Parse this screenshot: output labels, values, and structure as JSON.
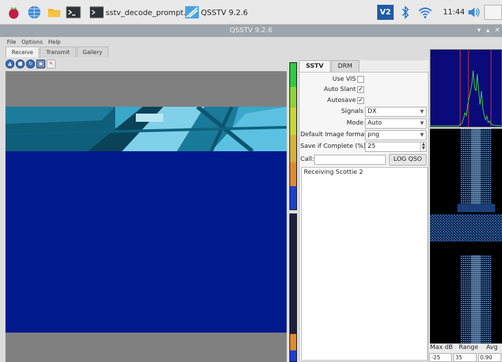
{
  "taskbar": {
    "tasks": [
      {
        "label": "sstv_decode_prompt.sh"
      },
      {
        "label": "QSSTV 9.2.6"
      }
    ],
    "clock": "11:44",
    "tray_v2": "V2"
  },
  "window": {
    "title": "QSSTV 9.2.6"
  },
  "menu": [
    "File",
    "Options",
    "Help"
  ],
  "main_tabs": [
    "Receive",
    "Transmit",
    "Gallery"
  ],
  "panel": {
    "tabs": [
      "SSTV",
      "DRM"
    ],
    "use_vis_label": "Use VIS",
    "use_vis_checked": false,
    "auto_slant_label": "Auto Slant",
    "auto_slant_checked": true,
    "autosave_label": "Autosave",
    "autosave_checked": true,
    "signals_label": "Signals",
    "signals_value": "DX",
    "mode_label": "Mode",
    "mode_value": "Auto",
    "format_label": "Default Image format",
    "format_value": "png",
    "save_label": "Save if Complete (%)",
    "save_value": "25",
    "call_label": "Call:",
    "call_value": "",
    "log_button": "LOG QSO",
    "status_text": "Receiving Scottie 2"
  },
  "spectrum_controls": {
    "maxdb_label": "Max dB",
    "range_label": "Range",
    "avg_label": "Avg",
    "maxdb_value": "-25",
    "range_value": "35",
    "avg_value": "0.90"
  }
}
